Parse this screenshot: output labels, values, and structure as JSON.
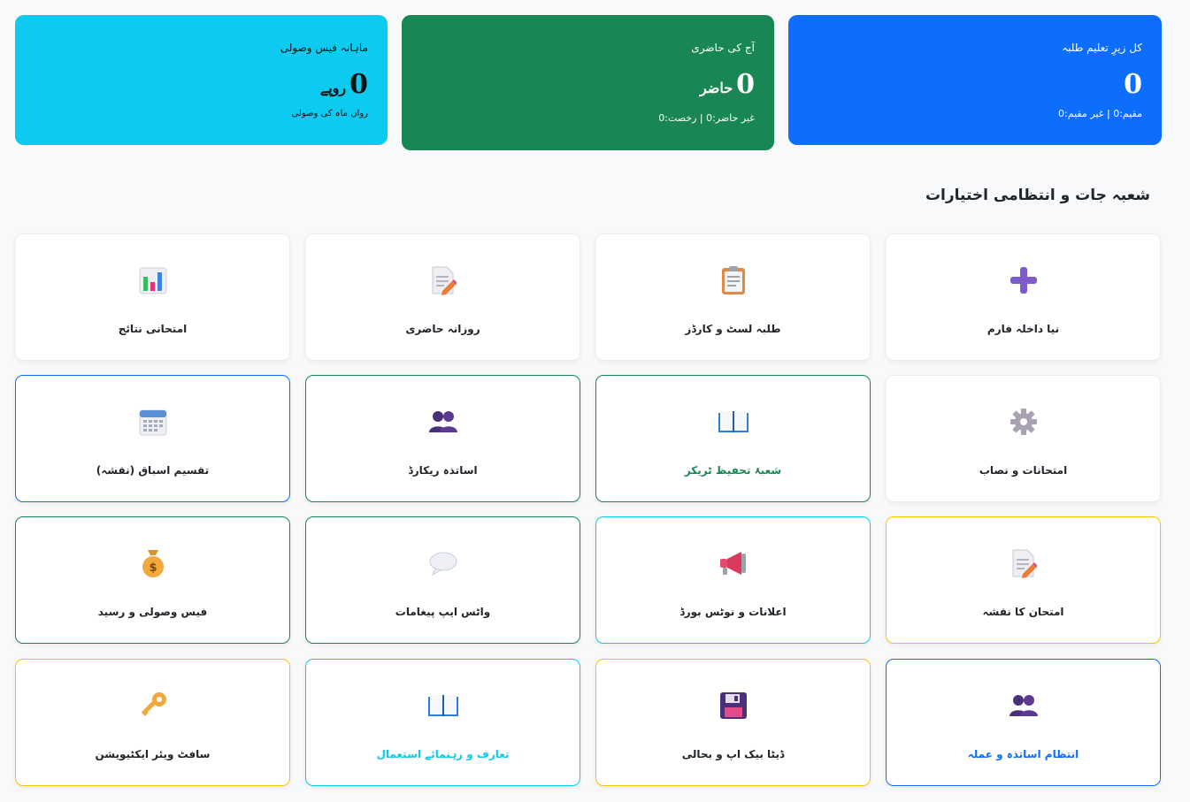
{
  "colors": {
    "primary": "#0d6efd",
    "success": "#198754",
    "info": "#0dcaf0",
    "warning": "#ffc107"
  },
  "stats": {
    "students": {
      "title": "کل زیرِ تعلیم طلبہ",
      "value": "0",
      "sub": "مقیم:0 | غیر مقیم:0"
    },
    "attendance": {
      "title": "آج کی حاضری",
      "value": "0",
      "unit": "حاضر",
      "sub": "غیر حاضر:0 | رخصت:0"
    },
    "fees": {
      "title": "ماہانہ فیس وصولی",
      "value": "0",
      "unit": "روپے",
      "sub": "رواں ماہ کی وصولی"
    }
  },
  "section_title": "شعبہ جات و انتظامی اختیارات",
  "tiles": [
    {
      "label": "نیا داخلہ فارم",
      "icon": "plus-icon"
    },
    {
      "label": "طلبہ لسٹ و کارڈز",
      "icon": "clipboard-icon"
    },
    {
      "label": "روزانہ حاضری",
      "icon": "memo-icon"
    },
    {
      "label": "امتحانی نتائج",
      "icon": "bar-chart-icon"
    },
    {
      "label": "امتحانات و نصاب",
      "icon": "gear-icon"
    },
    {
      "label": "شعبۂ تحفیظ ٹریکر",
      "icon": "open-book-icon"
    },
    {
      "label": "اساتذہ ریکارڈ",
      "icon": "people-icon"
    },
    {
      "label": "تقسیم اسباق (نقشہ)",
      "icon": "calendar-icon"
    },
    {
      "label": "امتحان کا نقشہ",
      "icon": "memo-icon"
    },
    {
      "label": "اعلانات و نوٹس بورڈ",
      "icon": "megaphone-icon"
    },
    {
      "label": "واٹس ایپ پیغامات",
      "icon": "speech-bubble-icon"
    },
    {
      "label": "فیس وصولی و رسید",
      "icon": "money-bag-icon"
    },
    {
      "label": "انتظام اساتذہ و عملہ",
      "icon": "people-icon"
    },
    {
      "label": "ڈیٹا بیک اپ و بحالی",
      "icon": "floppy-disk-icon"
    },
    {
      "label": "تعارف و رہنمائے استعمال",
      "icon": "open-book-icon"
    },
    {
      "label": "سافٹ ویئر ایکٹیویشن",
      "icon": "key-icon"
    }
  ]
}
